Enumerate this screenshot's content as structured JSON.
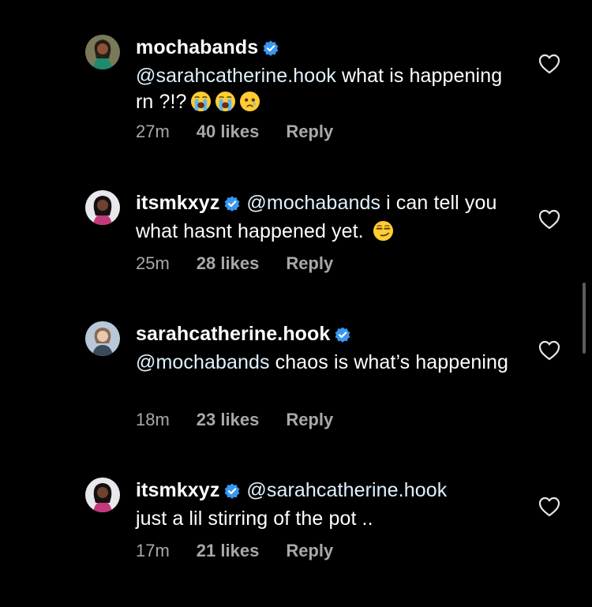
{
  "colors": {
    "background": "#000000",
    "text": "#ffffff",
    "mention": "#e0f1ff",
    "meta": "#a8a8a8",
    "verified": "#3897f0"
  },
  "comments": [
    {
      "username": "mochabands",
      "verified": true,
      "mention": "@sarahcatherine.hook",
      "text": " what is happening rn ?!?",
      "emojis": [
        "loudly-crying-face-emoji",
        "loudly-crying-face-emoji",
        "face-holding-back-tears-emoji"
      ],
      "time": "27m",
      "likes": "40 likes",
      "reply": "Reply"
    },
    {
      "username": "itsmkxyz",
      "verified": true,
      "mention": "@mochabands",
      "text": " i can tell you what hasnt happened yet. ",
      "emojis": [
        "smirking-face-emoji"
      ],
      "time": "25m",
      "likes": "28 likes",
      "reply": "Reply"
    },
    {
      "username": "sarahcatherine.hook",
      "verified": true,
      "mention": "@mochabands",
      "text": " chaos is what’s happening",
      "emojis": [],
      "time": "18m",
      "likes": "23 likes",
      "reply": "Reply"
    },
    {
      "username": "itsmkxyz",
      "verified": true,
      "mention": "@sarahcatherine.hook",
      "text": " just a lil stirring of the pot ..",
      "emojis": [],
      "time": "17m",
      "likes": "21 likes",
      "reply": "Reply"
    }
  ]
}
